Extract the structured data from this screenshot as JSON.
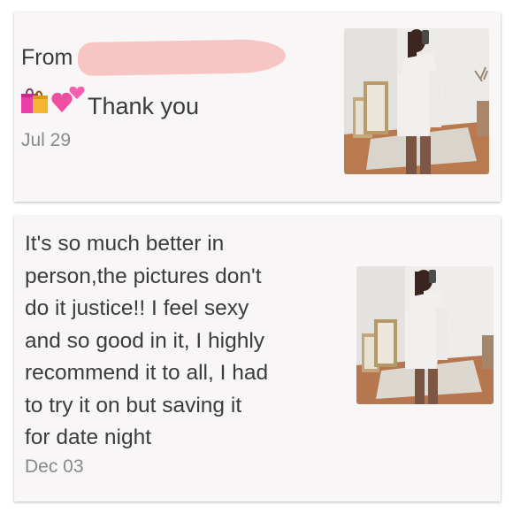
{
  "reviews": [
    {
      "from_label": "From",
      "message": "Thank you",
      "emojis": [
        "shopping-bags-icon",
        "two-hearts-icon"
      ],
      "date": "Jul 29"
    },
    {
      "message": "It's so much better in\nperson,the pictures don't\ndo it justice!! I feel sexy\nand so good in it, I highly\nrecommend it to all, I had\nto try it on but saving it\nfor date night",
      "date": "Dec 03"
    }
  ],
  "colors": {
    "card_background": "#f8f6f7",
    "redaction": "#f7c6c2",
    "text": "#3a3a3a",
    "date_text": "#8a8a8a"
  }
}
